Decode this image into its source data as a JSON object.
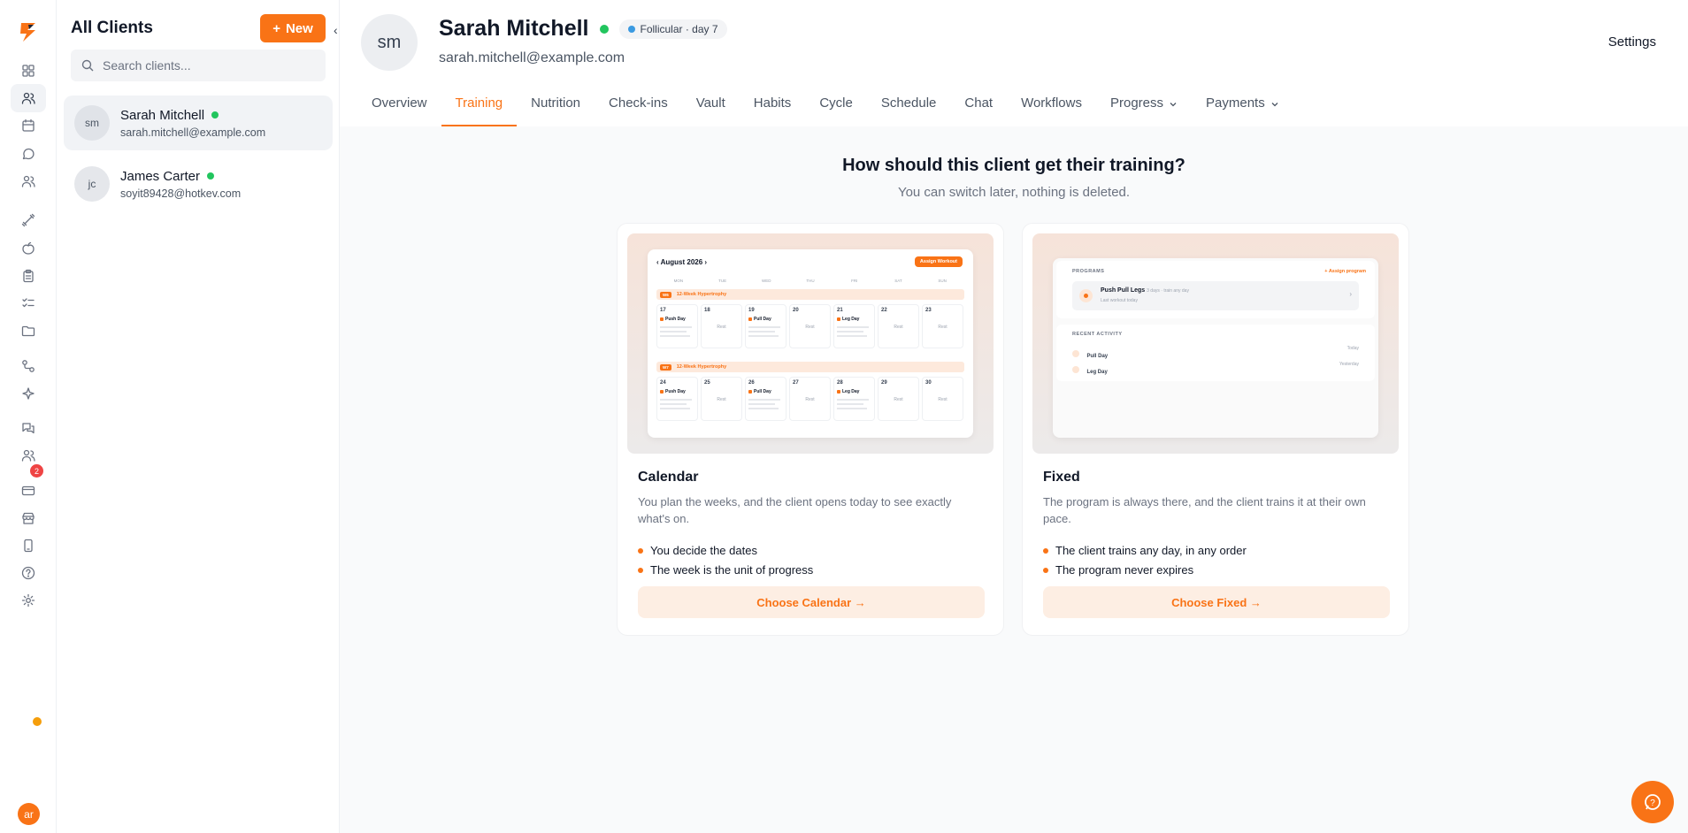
{
  "list": {
    "title": "All Clients",
    "new_label": "New",
    "search_placeholder": "Search clients...",
    "clients": [
      {
        "initials": "sm",
        "name": "Sarah Mitchell",
        "email": "sarah.mitchell@example.com"
      },
      {
        "initials": "jc",
        "name": "James Carter",
        "email": "soyit89428@hotkev.com"
      }
    ]
  },
  "rail": {
    "notifications_badge": "2",
    "user_initials": "ar",
    "icons": [
      "dashboard-icon",
      "clients-icon",
      "calendar-icon",
      "messages-icon",
      "team-icon",
      "dumbbell-icon",
      "nutrition-icon",
      "clipboard-icon",
      "checklist-icon",
      "folder-icon",
      "workflow-icon",
      "sparkle-icon",
      "chat-icon",
      "community-icon",
      "billing-icon",
      "store-icon",
      "mobile-icon",
      "help-icon",
      "settings-icon"
    ]
  },
  "profile": {
    "initials": "sm",
    "name": "Sarah Mitchell",
    "phase": "Follicular · day 7",
    "email": "sarah.mitchell@example.com",
    "settings_label": "Settings"
  },
  "tabs": [
    "Overview",
    "Training",
    "Nutrition",
    "Check-ins",
    "Vault",
    "Habits",
    "Cycle",
    "Schedule",
    "Chat",
    "Workflows",
    "Progress",
    "Payments"
  ],
  "active_tab": "Training",
  "question": {
    "title": "How should this client get their training?",
    "subtitle": "You can switch later, nothing is deleted."
  },
  "calendar_card": {
    "title": "Calendar",
    "description": "You plan the weeks, and the client opens today to see exactly what's on.",
    "bullets": [
      "You decide the dates",
      "The week is the unit of progress"
    ],
    "cta": "Choose Calendar →",
    "preview": {
      "month": "August 2026",
      "assign": "Assign Workout",
      "weekdays": [
        "MON",
        "TUE",
        "WED",
        "THU",
        "FRI",
        "SAT",
        "SUN"
      ],
      "weeks": [
        {
          "tag": "W6",
          "program": "12-Week Hypertrophy",
          "days": [
            {
              "d": "17",
              "w": "Push Day"
            },
            {
              "d": "18",
              "w": "Rest"
            },
            {
              "d": "19",
              "w": "Pull Day"
            },
            {
              "d": "20",
              "w": "Rest"
            },
            {
              "d": "21",
              "w": "Leg Day"
            },
            {
              "d": "22",
              "w": "Rest"
            },
            {
              "d": "23",
              "w": "Rest"
            }
          ]
        },
        {
          "tag": "W7",
          "program": "12-Week Hypertrophy",
          "days": [
            {
              "d": "24",
              "w": "Push Day"
            },
            {
              "d": "25",
              "w": "Rest"
            },
            {
              "d": "26",
              "w": "Pull Day"
            },
            {
              "d": "27",
              "w": "Rest"
            },
            {
              "d": "28",
              "w": "Leg Day"
            },
            {
              "d": "29",
              "w": "Rest"
            },
            {
              "d": "30",
              "w": "Rest"
            }
          ]
        }
      ]
    }
  },
  "fixed_card": {
    "title": "Fixed",
    "description": "The program is always there, and the client trains it at their own pace.",
    "bullets": [
      "The client trains any day, in any order",
      "The program never expires"
    ],
    "cta": "Choose Fixed →",
    "preview": {
      "programs_label": "PROGRAMS",
      "assign": "+ Assign program",
      "program_name": "Push Pull Legs",
      "program_meta": "3 days · train any day",
      "program_sub": "Last workout today",
      "activity_label": "RECENT ACTIVITY",
      "activity": [
        {
          "name": "Pull Day",
          "when": "Today"
        },
        {
          "name": "Leg Day",
          "when": "Yesterday"
        }
      ]
    }
  }
}
